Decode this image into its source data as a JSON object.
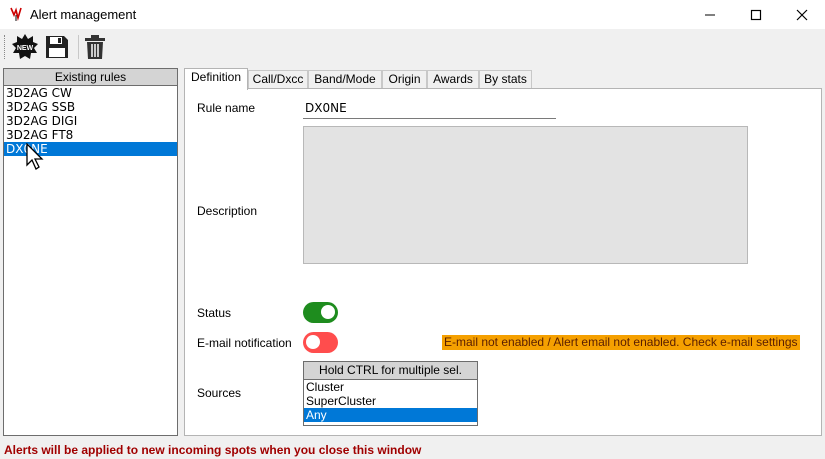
{
  "window": {
    "title": "Alert management",
    "app_icon": "wavy-antenna-icon"
  },
  "toolbar": {
    "new_label": "NEW",
    "new_icon": "new-starburst-icon",
    "save_icon": "floppy-disk-icon",
    "delete_icon": "trash-can-icon"
  },
  "rules": {
    "header": "Existing rules",
    "items": [
      "3D2AG CW",
      "3D2AG SSB",
      "3D2AG DIGI",
      "3D2AG FT8",
      "DX0NE"
    ],
    "selected": "DX0NE"
  },
  "tabs": [
    "Definition",
    "Call/Dxcc",
    "Band/Mode",
    "Origin",
    "Awards",
    "By stats"
  ],
  "active_tab": "Definition",
  "definition": {
    "rule_name_label": "Rule name",
    "rule_name_value": "DX0NE",
    "description_label": "Description",
    "status_label": "Status",
    "status_on": true,
    "email_label": "E-mail notification",
    "email_on": false,
    "email_warning": "E-mail not enabled / Alert email not enabled. Check e-mail settings",
    "sources_label": "Sources",
    "sources_header": "Hold CTRL for multiple sel.",
    "sources_options": [
      "Cluster",
      "SuperCluster",
      "Any"
    ],
    "sources_selected": "Any"
  },
  "status_bar": {
    "text": "Alerts will be applied to new incoming spots when you close this window"
  },
  "colors": {
    "selection": "#0078d7",
    "toggle_on": "#1e8c1e",
    "toggle_off": "#ff4d4d",
    "warning_bg": "#f5a000",
    "status_text": "#a00000"
  }
}
